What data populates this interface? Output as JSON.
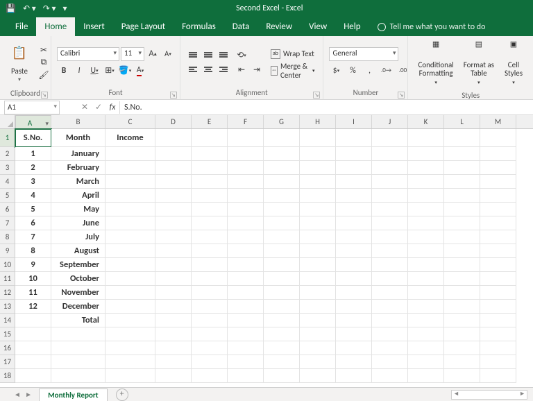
{
  "titlebar": {
    "title": "Second Excel  -  Excel"
  },
  "tabs": {
    "file": "File",
    "home": "Home",
    "insert": "Insert",
    "pagelayout": "Page Layout",
    "formulas": "Formulas",
    "data": "Data",
    "review": "Review",
    "view": "View",
    "help": "Help",
    "tellme": "Tell me what you want to do"
  },
  "ribbon": {
    "clipboard": {
      "label": "Clipboard",
      "paste": "Paste"
    },
    "font": {
      "label": "Font",
      "name": "Calibri",
      "size": "11",
      "bold": "B",
      "italic": "I",
      "underline": "U",
      "increase": "A",
      "decrease": "A"
    },
    "alignment": {
      "label": "Alignment",
      "wrap": "Wrap Text",
      "merge": "Merge & Center"
    },
    "number": {
      "label": "Number",
      "format": "General",
      "currency": "$",
      "percent": "%",
      "comma": ","
    },
    "styles": {
      "label": "Styles",
      "cond": "Conditional\nFormatting",
      "table": "Format as\nTable",
      "cell": "Cell\nStyles"
    }
  },
  "namebox": "A1",
  "formula": "S.No.",
  "columns": [
    "A",
    "B",
    "C",
    "D",
    "E",
    "F",
    "G",
    "H",
    "I",
    "J",
    "K",
    "L",
    "M"
  ],
  "rows": [
    "1",
    "2",
    "3",
    "4",
    "5",
    "6",
    "7",
    "8",
    "9",
    "10",
    "11",
    "12",
    "13",
    "14",
    "15",
    "16",
    "17",
    "18"
  ],
  "headers": {
    "sno": "S.No.",
    "month": "Month",
    "income": "Income"
  },
  "data": [
    {
      "n": "1",
      "m": "January"
    },
    {
      "n": "2",
      "m": "February"
    },
    {
      "n": "3",
      "m": "March"
    },
    {
      "n": "4",
      "m": "April"
    },
    {
      "n": "5",
      "m": "May"
    },
    {
      "n": "6",
      "m": "June"
    },
    {
      "n": "7",
      "m": "July"
    },
    {
      "n": "8",
      "m": "August"
    },
    {
      "n": "9",
      "m": "September"
    },
    {
      "n": "10",
      "m": "October"
    },
    {
      "n": "11",
      "m": "November"
    },
    {
      "n": "12",
      "m": "December"
    }
  ],
  "total": "Total",
  "sheet": {
    "name": "Monthly Report"
  }
}
